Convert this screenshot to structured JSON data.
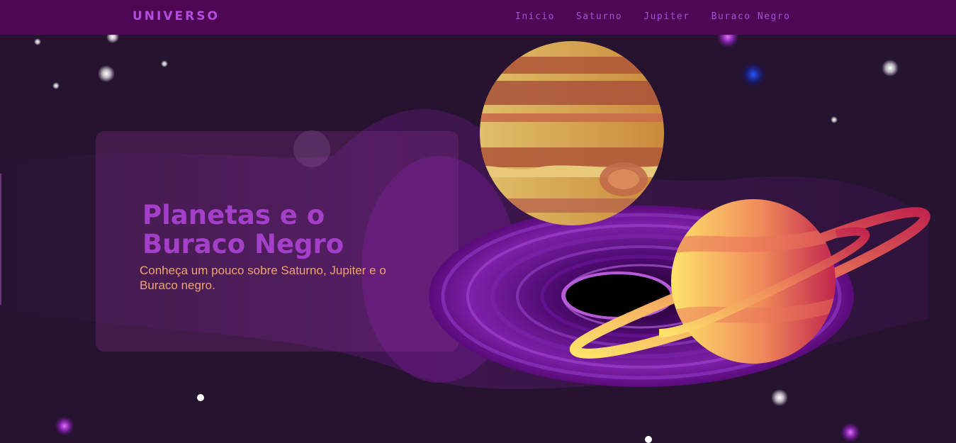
{
  "header": {
    "brand": "UNIVERSO",
    "nav": [
      {
        "label": "Inicio"
      },
      {
        "label": "Saturno"
      },
      {
        "label": "Jupiter"
      },
      {
        "label": "Buraco Negro"
      }
    ]
  },
  "hero": {
    "title_line1": "Planetas e o",
    "title_line2": "Buraco Negro",
    "subtitle": "Conheça um pouco sobre Saturno, Jupiter e o Buraco negro."
  },
  "colors": {
    "header_bg": "#4e0755",
    "page_bg": "#26132f",
    "accent": "#a43fc9",
    "subtitle": "#f0a46e"
  },
  "icons": {
    "jupiter": "jupiter-illustration",
    "saturn": "saturn-illustration",
    "black_hole": "black-hole-illustration"
  }
}
